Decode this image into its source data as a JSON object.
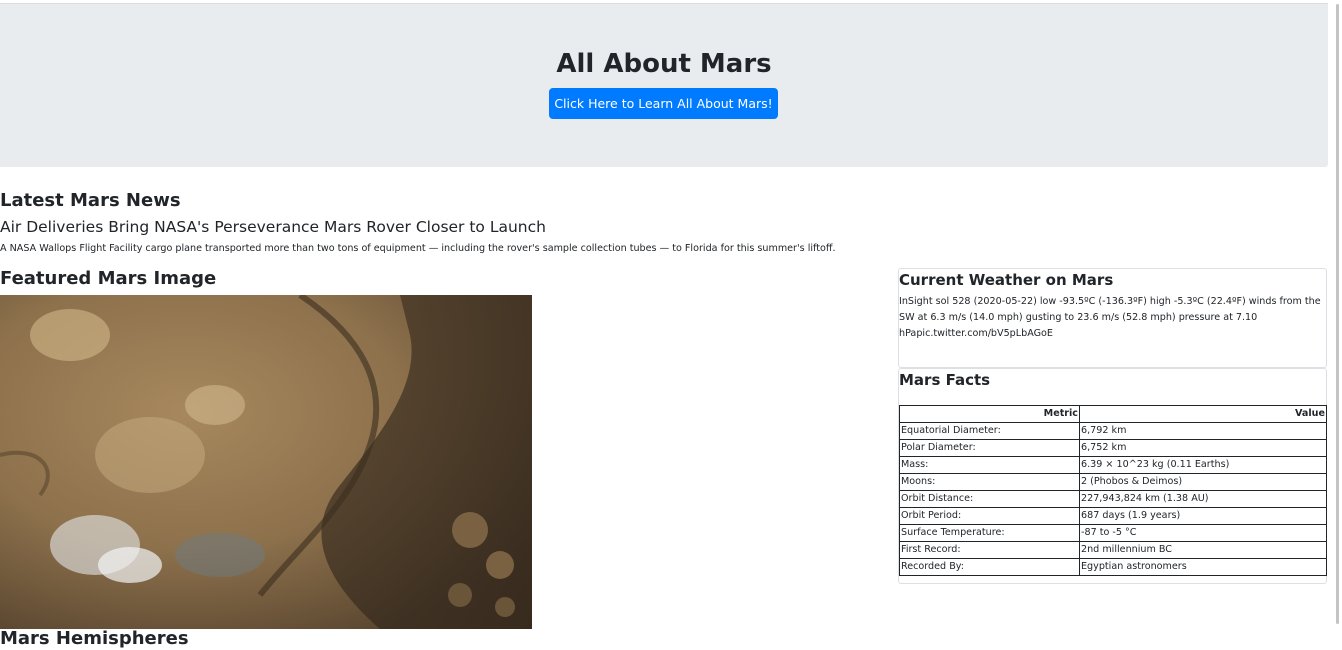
{
  "header": {
    "title": "All About Mars",
    "learn_button": "Click Here to Learn All About Mars!"
  },
  "news": {
    "heading": "Latest Mars News",
    "title": "Air Deliveries Bring NASA's Perseverance Mars Rover Closer to Launch",
    "teaser": "A NASA Wallops Flight Facility cargo plane transported more than two tons of equipment — including the rover's sample collection tubes — to Florida for this summer's liftoff."
  },
  "featured": {
    "heading": "Featured Mars Image"
  },
  "weather": {
    "heading": "Current Weather on Mars",
    "text": "InSight sol 528 (2020-05-22) low -93.5ºC (-136.3ºF) high -5.3ºC (22.4ºF) winds from the SW at 6.3 m/s (14.0 mph) gusting to 23.6 m/s (52.8 mph) pressure at 7.10 hPapic.twitter.com/bV5pLbAGoE"
  },
  "facts": {
    "heading": "Mars Facts",
    "columns": [
      "Metric",
      "Value"
    ],
    "rows": [
      [
        "Equatorial Diameter:",
        "6,792 km"
      ],
      [
        "Polar Diameter:",
        "6,752 km"
      ],
      [
        "Mass:",
        "6.39 × 10^23 kg (0.11 Earths)"
      ],
      [
        "Moons:",
        "2 (Phobos & Deimos)"
      ],
      [
        "Orbit Distance:",
        "227,943,824 km (1.38 AU)"
      ],
      [
        "Orbit Period:",
        "687 days (1.9 years)"
      ],
      [
        "Surface Temperature:",
        "-87 to -5 °C"
      ],
      [
        "First Record:",
        "2nd millennium BC"
      ],
      [
        "Recorded By:",
        "Egyptian astronomers"
      ]
    ]
  },
  "hemispheres": {
    "heading": "Mars Hemispheres"
  },
  "colors": {
    "jumbotron": "#e9ecef",
    "primary": "#007bff"
  }
}
